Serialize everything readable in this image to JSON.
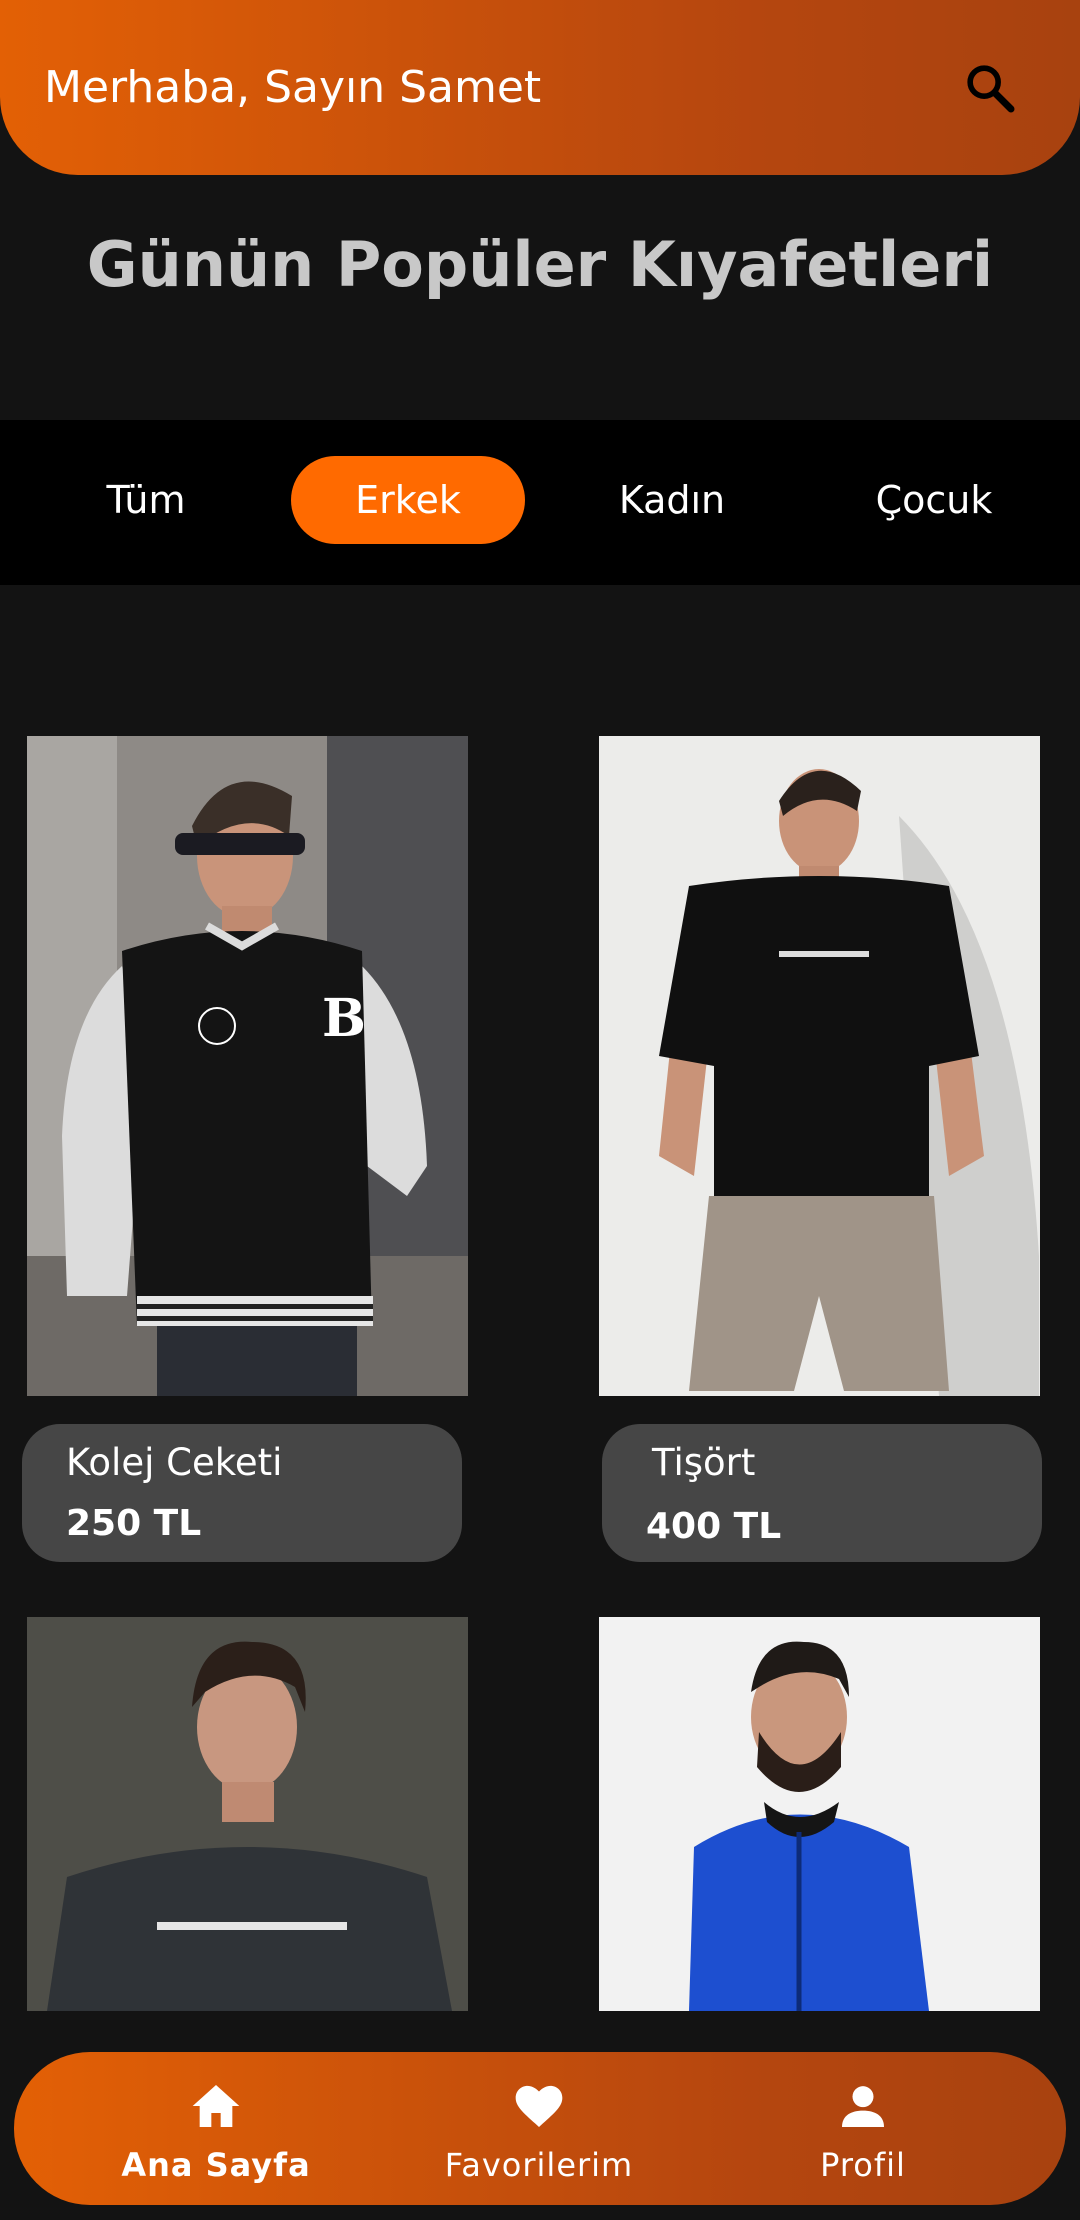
{
  "header": {
    "greeting": "Merhaba, Sayın Samet",
    "search_icon": "search-icon"
  },
  "section_title": "Günün Popüler Kıyafetleri",
  "categories": [
    {
      "label": "Tüm",
      "active": false
    },
    {
      "label": "Erkek",
      "active": true
    },
    {
      "label": "Kadın",
      "active": false
    },
    {
      "label": "Çocuk",
      "active": false
    }
  ],
  "products": [
    {
      "name": "Kolej Ceketi",
      "price": "250 TL",
      "image": "man-in-black-varsity-jacket"
    },
    {
      "name": "Tişört",
      "price": "400 TL",
      "image": "man-in-black-tshirt-and-shorts"
    },
    {
      "name": "",
      "price": "",
      "image": "man-in-dark-sweatshirt"
    },
    {
      "name": "",
      "price": "",
      "image": "man-in-blue-zip-hoodie"
    }
  ],
  "bottom_nav": [
    {
      "label": "Ana Sayfa",
      "icon": "home-icon",
      "active": true
    },
    {
      "label": "Favorilerim",
      "icon": "heart-icon",
      "active": false
    },
    {
      "label": "Profil",
      "icon": "person-icon",
      "active": false
    }
  ],
  "colors": {
    "accent": "#ff6a00",
    "header_gradient_start": "#e36005",
    "header_gradient_end": "#a8420f",
    "background": "#131313",
    "tab_bar": "#000000",
    "card_info": "#464646",
    "title_text": "#c8c8c8"
  }
}
